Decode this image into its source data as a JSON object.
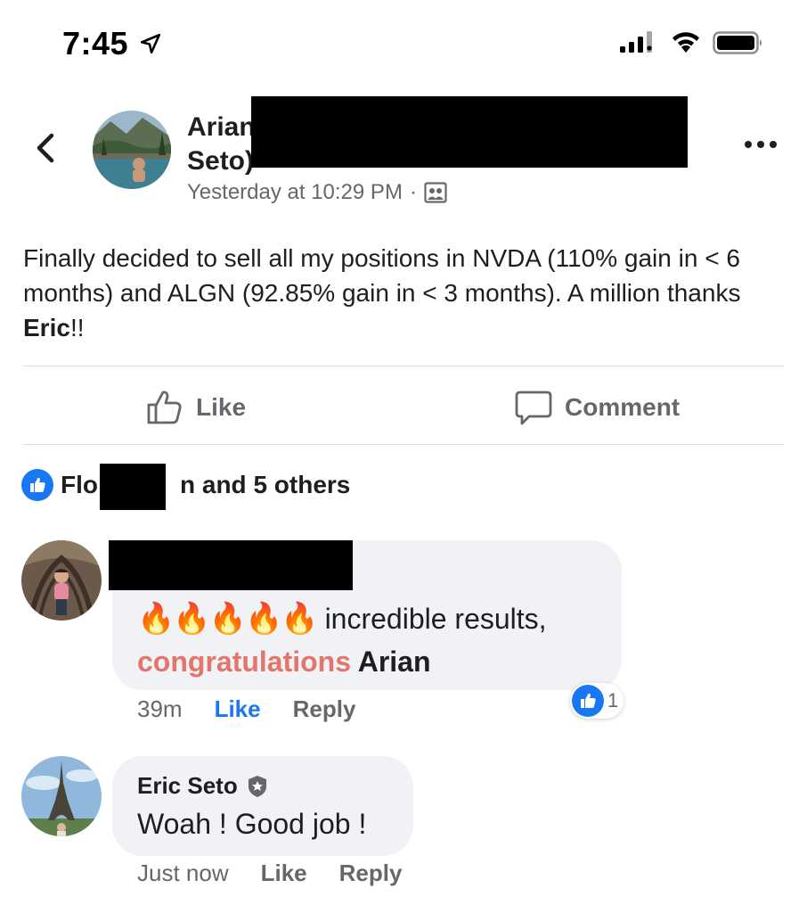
{
  "status_bar": {
    "time": "7:45",
    "icons": [
      "location-arrow-icon",
      "cellular-signal-icon",
      "wifi-icon",
      "battery-icon"
    ]
  },
  "post": {
    "author_first": "Arian",
    "author_last": "Seto)",
    "timestamp": "Yesterday at 10:29 PM",
    "separator": "·",
    "audience_icon": "friends-audience-icon",
    "text_before": "Finally decided to sell all my positions in NVDA (110% gain in < 6 months) and ALGN (92.85% gain in < 3 months). A million thanks ",
    "mention": "Eric",
    "text_after": "!!"
  },
  "actions": {
    "like_label": "Like",
    "comment_label": "Comment"
  },
  "reactions": {
    "prefix": "Flo",
    "suffix": "n and 5 others"
  },
  "comments": [
    {
      "emoji": "🔥🔥🔥🔥🔥",
      "text_part1": " incredible results,",
      "highlight": "congratulations",
      "text_part2": " Arian",
      "reaction_count": "1",
      "time": "39m",
      "like": "Like",
      "reply": "Reply"
    },
    {
      "author": "Eric Seto",
      "text": "Woah ! Good job !",
      "time": "Just now",
      "like": "Like",
      "reply": "Reply"
    }
  ],
  "colors": {
    "accent": "#1877f2",
    "secondary_text": "#65676b",
    "bubble": "#f0f2f5",
    "congrats": "#e4756a"
  }
}
